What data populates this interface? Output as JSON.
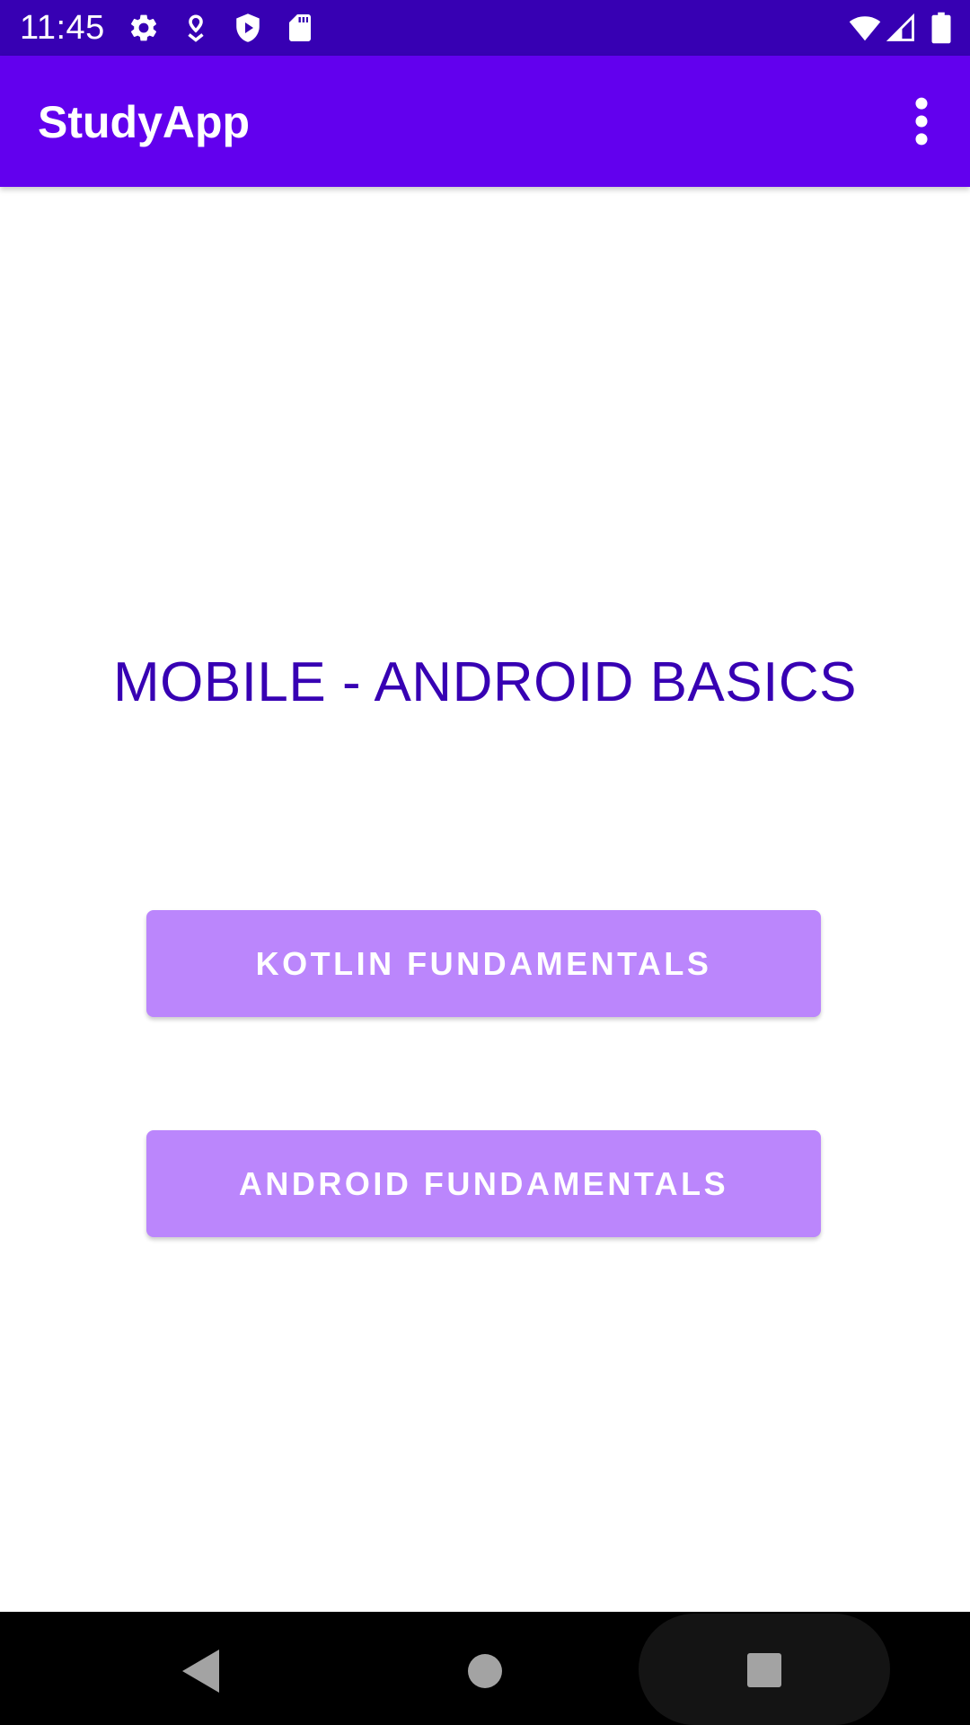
{
  "status_bar": {
    "time": "11:45",
    "background": "#3700b3",
    "left_icons": [
      "settings-gear-icon",
      "location-pin-icon",
      "shield-play-icon",
      "sd-card-icon"
    ],
    "right_icons": [
      "wifi-icon",
      "cell-signal-icon",
      "battery-icon"
    ]
  },
  "app_bar": {
    "title": "StudyApp",
    "background": "#6200ee",
    "menu_icon": "more-vertical-icon"
  },
  "main": {
    "heading": "MOBILE - ANDROID BASICS",
    "heading_color": "#3700b3",
    "buttons": [
      {
        "label": "KOTLIN FUNDAMENTALS",
        "color": "#bb86fc"
      },
      {
        "label": "ANDROID FUNDAMENTALS",
        "color": "#bb86fc"
      }
    ]
  },
  "nav_bar": {
    "background": "#000000",
    "buttons": [
      "back-triangle-icon",
      "home-circle-icon",
      "recents-square-icon"
    ]
  }
}
